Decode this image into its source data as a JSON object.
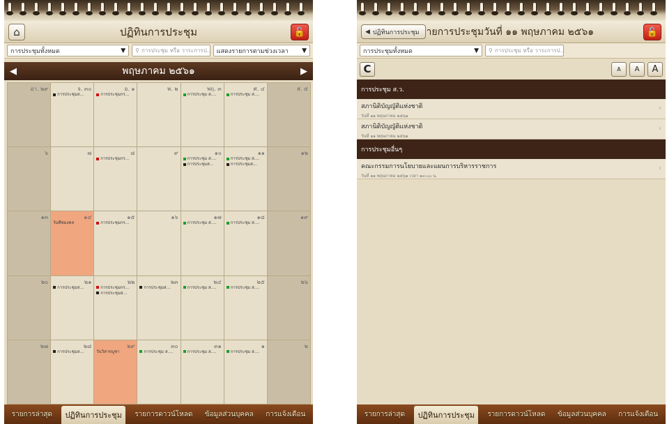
{
  "left": {
    "title": "ปฏิทินการประชุม",
    "filter_select": "การประชุมทั้งหมด",
    "search_placeholder": "การประชุม หรือ วาระการป...",
    "view_select": "แสดงรายการตามช่วงเวลา",
    "month": "พฤษภาคม ๒๕๖๑",
    "weeks": [
      [
        {
          "num": "อา. ๒๙",
          "weekend": true,
          "events": []
        },
        {
          "num": "จ. ๓๐",
          "events": [
            {
              "text": "การประชุมส...",
              "color": "black"
            }
          ]
        },
        {
          "num": "อ. ๑",
          "events": [
            {
              "text": "การประชุมกร...",
              "color": "red"
            }
          ]
        },
        {
          "num": "พ. ๒",
          "events": []
        },
        {
          "num": "พฤ. ๓",
          "events": [
            {
              "text": "การประชุม ส....",
              "color": "green"
            }
          ]
        },
        {
          "num": "ศ. ๔",
          "events": [
            {
              "text": "การประชุม ส....",
              "color": "green"
            }
          ]
        },
        {
          "num": "ส. ๕",
          "weekend": true,
          "events": []
        }
      ],
      [
        {
          "num": "๖",
          "weekend": true,
          "events": []
        },
        {
          "num": "๗",
          "events": []
        },
        {
          "num": "๘",
          "events": [
            {
              "text": "การประชุมกร...",
              "color": "red"
            }
          ]
        },
        {
          "num": "๙",
          "events": []
        },
        {
          "num": "๑๐",
          "events": [
            {
              "text": "การประชุม ส....",
              "color": "green"
            },
            {
              "text": "การประชุมส...",
              "color": "black"
            }
          ]
        },
        {
          "num": "๑๑",
          "events": [
            {
              "text": "การประชุม ส....",
              "color": "green"
            },
            {
              "text": "การประชุมส...",
              "color": "black"
            }
          ]
        },
        {
          "num": "๑๒",
          "weekend": true,
          "events": []
        }
      ],
      [
        {
          "num": "๑๓",
          "weekend": true,
          "events": []
        },
        {
          "num": "๑๔",
          "holiday": true,
          "events": [
            {
              "text": "วันพืชมงคล",
              "color": "plain"
            }
          ]
        },
        {
          "num": "๑๕",
          "events": [
            {
              "text": "การประชุมกร...",
              "color": "red"
            }
          ]
        },
        {
          "num": "๑๖",
          "events": []
        },
        {
          "num": "๑๗",
          "events": [
            {
              "text": "การประชุม ส....",
              "color": "green"
            }
          ]
        },
        {
          "num": "๑๘",
          "events": [
            {
              "text": "การประชุม ส....",
              "color": "green"
            }
          ]
        },
        {
          "num": "๑๙",
          "weekend": true,
          "events": []
        }
      ],
      [
        {
          "num": "๒๐",
          "weekend": true,
          "events": []
        },
        {
          "num": "๒๑",
          "events": [
            {
              "text": "การประชุมส...",
              "color": "black"
            }
          ]
        },
        {
          "num": "๒๒",
          "events": [
            {
              "text": "การประชุมกร...",
              "color": "red"
            },
            {
              "text": "การประชุมส...",
              "color": "black"
            }
          ]
        },
        {
          "num": "๒๓",
          "events": [
            {
              "text": "การประชุมส...",
              "color": "black"
            }
          ]
        },
        {
          "num": "๒๔",
          "events": [
            {
              "text": "การประชุม ส....",
              "color": "green"
            }
          ]
        },
        {
          "num": "๒๕",
          "events": [
            {
              "text": "การประชุม ส....",
              "color": "green"
            }
          ]
        },
        {
          "num": "๒๖",
          "weekend": true,
          "events": []
        }
      ],
      [
        {
          "num": "๒๗",
          "weekend": true,
          "events": []
        },
        {
          "num": "๒๘",
          "events": [
            {
              "text": "การประชุมส...",
              "color": "black"
            }
          ]
        },
        {
          "num": "๒๙",
          "holiday": true,
          "events": [
            {
              "text": "วันวิสาขบูชา",
              "color": "plain"
            }
          ]
        },
        {
          "num": "๓๐",
          "events": [
            {
              "text": "การประชุม ส....",
              "color": "green"
            }
          ]
        },
        {
          "num": "๓๑",
          "events": [
            {
              "text": "การประชุม ส....",
              "color": "green"
            }
          ]
        },
        {
          "num": "๑",
          "events": [
            {
              "text": "การประชุม ส....",
              "color": "green"
            }
          ]
        },
        {
          "num": "๒",
          "weekend": true,
          "events": []
        }
      ]
    ]
  },
  "right": {
    "back_label": "ปฏิทินการประชุม",
    "title": "รายการประชุมวันที่ ๑๑ พฤษภาคม ๒๕๖๑",
    "filter_select": "การประชุมทั้งหมด",
    "search_placeholder": "การประชุม หรือ วาระการป...",
    "font_small": "A",
    "font_medium": "A",
    "font_large": "A",
    "sections": [
      {
        "head": "การประชุม ส.ว.",
        "items": [
          {
            "title": "สภานิติบัญญัติแห่งชาติ",
            "sub": "วันที่ ๑๑ พฤษภาคม ๒๕๖๑"
          },
          {
            "title": "สภานิติบัญญัติแห่งชาติ",
            "sub": "วันที่ ๑๑ พฤษภาคม ๒๕๖๑"
          }
        ]
      },
      {
        "head": "การประชุมอื่นๆ",
        "items": [
          {
            "title": "คณะกรรมการนโยบายและแผนการบริหารราชการ",
            "sub": "วันที่ ๑๑ พฤษภาคม ๒๕๖๑ เวลา ๑๓:๐๐ น."
          }
        ]
      }
    ]
  },
  "tabs": [
    "รายการล่าสุด",
    "ปฏิทินการประชุม",
    "รายการดาวน์โหลด",
    "ข้อมูลส่วนบุคคล",
    "การแจ้งเตือน"
  ],
  "active_tab": 1,
  "colors": {
    "header_brown": "#3d2417",
    "holiday": "#f0a67e",
    "lock_red": "#c21f14"
  }
}
